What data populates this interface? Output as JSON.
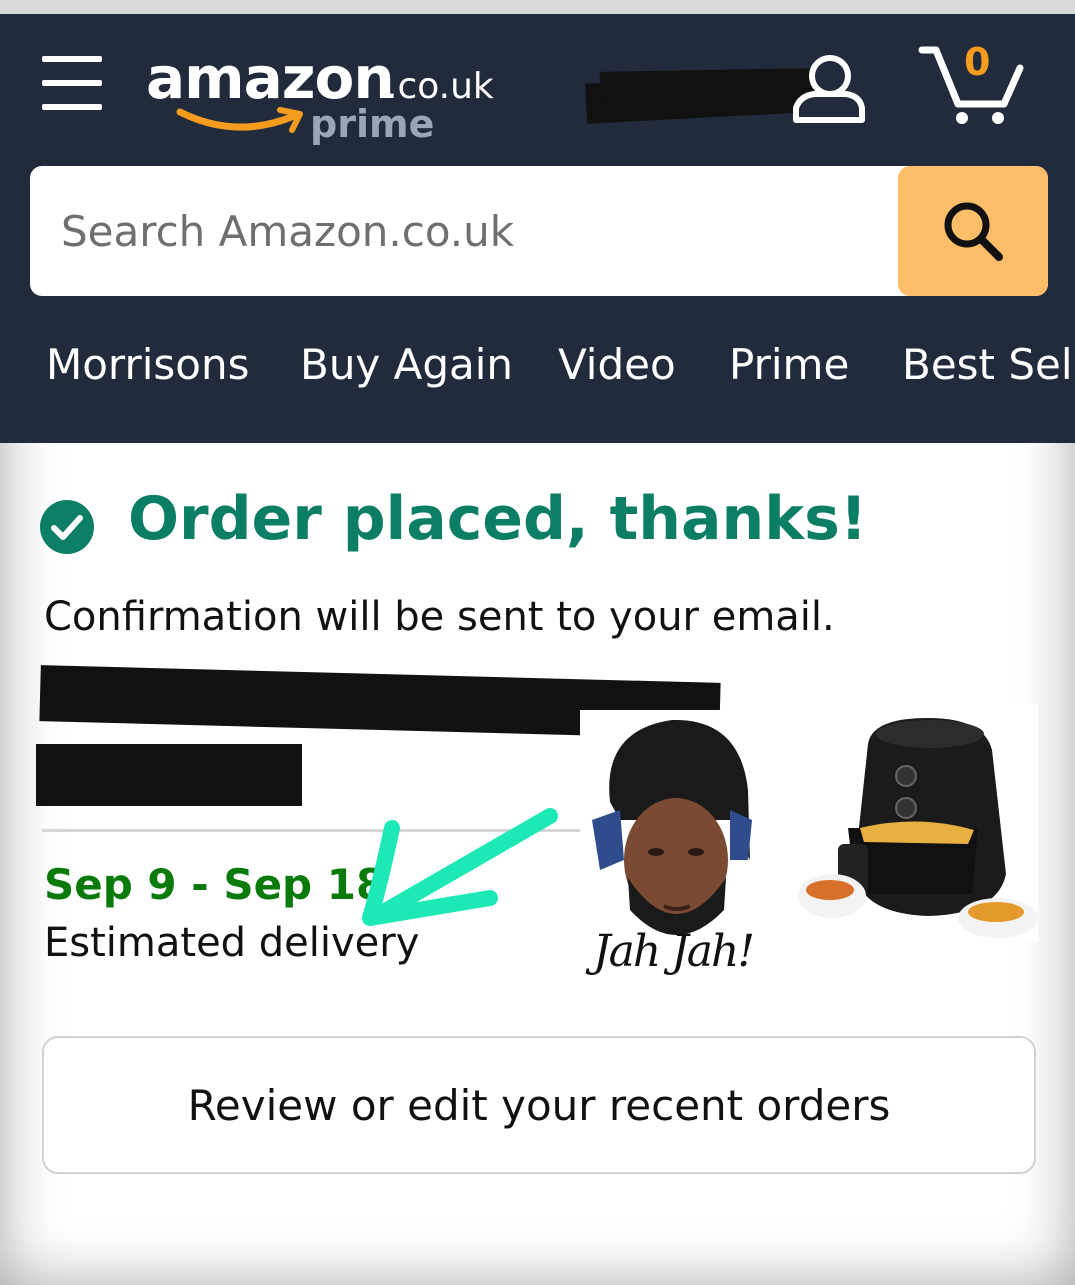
{
  "header": {
    "logo_word": "amazon",
    "logo_tld": ".co.uk",
    "logo_sub": "prime",
    "cart_count": "0"
  },
  "search": {
    "placeholder": "Search Amazon.co.uk"
  },
  "nav": {
    "items": [
      {
        "label": "Morrisons"
      },
      {
        "label": "Buy Again"
      },
      {
        "label": "Video"
      },
      {
        "label": "Prime"
      },
      {
        "label": "Best Sellers"
      }
    ]
  },
  "order": {
    "title": "Order placed, thanks!",
    "confirmation": "Confirmation will be sent to your email.",
    "delivery_dates": "Sep 9 - Sep 18",
    "delivery_label": "Estimated delivery",
    "review_button": "Review or edit your recent orders"
  },
  "thumbnails": {
    "person_caption": "Jah Jah!"
  },
  "colors": {
    "header_bg": "#222b3b",
    "search_button": "#febd69",
    "title_green": "#0c7e66",
    "date_green": "#0a7a0a",
    "cart_count": "#f59b1d",
    "annotation_arrow": "#1de9b6"
  },
  "icons": [
    "menu-icon",
    "account-icon",
    "cart-icon",
    "search-icon",
    "check-circle-icon"
  ]
}
